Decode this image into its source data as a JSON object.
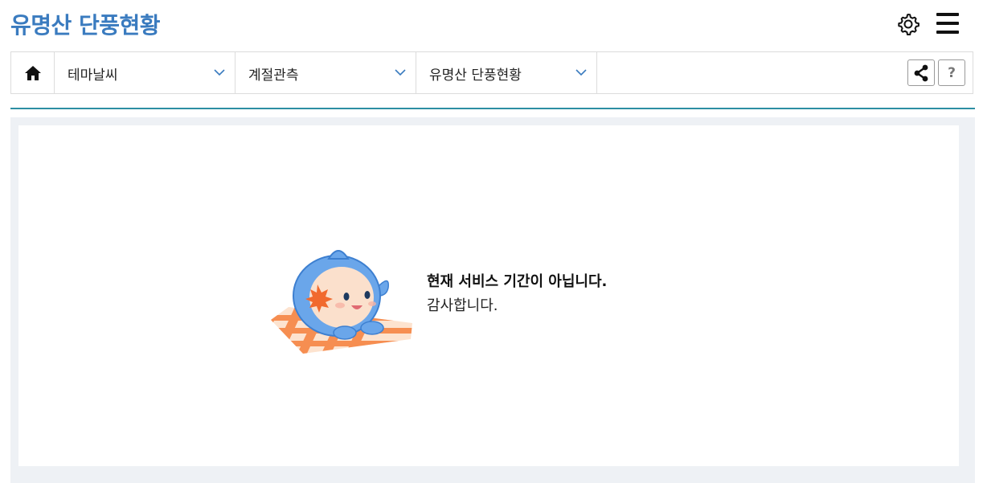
{
  "header": {
    "title": "유명산 단풍현황"
  },
  "icons": {
    "settings": "gear-icon",
    "menu": "hamburger-menu-icon",
    "home": "home-icon",
    "share": "share-icon",
    "help": "help-icon",
    "dropdown": "chevron-down-icon"
  },
  "nav": {
    "dropdowns": [
      {
        "label": "테마날씨"
      },
      {
        "label": "계절관측"
      },
      {
        "label": "유명산 단풍현황"
      }
    ],
    "help_label": "?"
  },
  "message": {
    "primary": "현재 서비스 기간이 아닙니다.",
    "secondary": "감사합니다."
  },
  "colors": {
    "title": "#3a7bbf",
    "divider": "#2d8fa3",
    "chevron": "#3a7bbf",
    "content_bg": "#eef1f5"
  }
}
